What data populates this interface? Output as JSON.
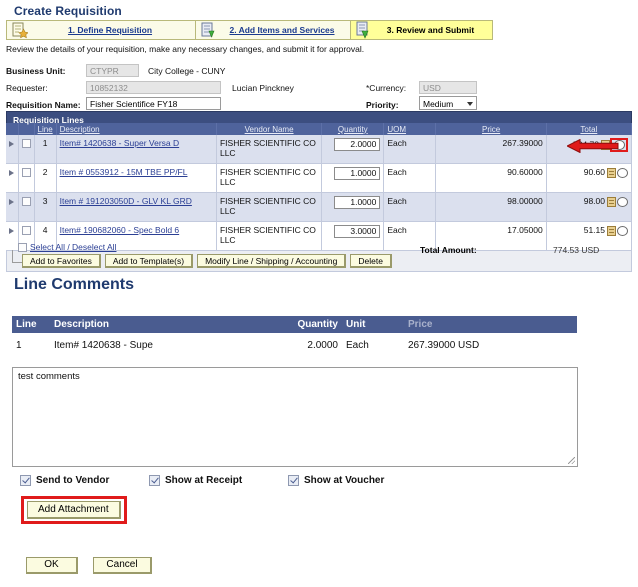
{
  "page": {
    "title": "Create Requisition",
    "intro": "Review the details of your requisition, make any necessary changes, and submit it for approval."
  },
  "steps": [
    {
      "label": "1. Define Requisition",
      "icon": "new-document-icon",
      "active": false
    },
    {
      "label": "2. Add Items and Services",
      "icon": "add-items-icon",
      "active": false
    },
    {
      "label": "3. Review and Submit",
      "icon": "review-submit-icon",
      "active": true
    }
  ],
  "header_form": {
    "business_unit_label": "Business Unit:",
    "business_unit_value": "CTYPR",
    "business_unit_desc": "City College - CUNY",
    "requester_label": "Requester:",
    "requester_value": "10852132",
    "requester_name": "Lucian Pinckney",
    "requisition_name_label": "Requisition Name:",
    "requisition_name_value": "Fisher Scientifice FY18",
    "currency_label": "*Currency:",
    "currency_value": "USD",
    "priority_label": "Priority:",
    "priority_value": "Medium"
  },
  "lines_grid": {
    "title": "Requisition Lines",
    "columns": [
      "Line",
      "Description",
      "Vendor Name",
      "Quantity",
      "UOM",
      "Price",
      "Total"
    ],
    "rows": [
      {
        "line": "1",
        "description": "Item# 1420638 - Super Versa D",
        "vendor": "FISHER SCIENTIFIC CO LLC",
        "quantity": "2.0000",
        "uom": "Each",
        "price": "267.39000",
        "total": "534.78",
        "highlighted": true
      },
      {
        "line": "2",
        "description": "Item # 0553912 - 15M TBE PP/FL",
        "vendor": "FISHER SCIENTIFIC CO LLC",
        "quantity": "1.0000",
        "uom": "Each",
        "price": "90.60000",
        "total": "90.60",
        "highlighted": false
      },
      {
        "line": "3",
        "description": "Item # 191203050D - GLV KL GRD",
        "vendor": "FISHER SCIENTIFIC CO LLC",
        "quantity": "1.0000",
        "uom": "Each",
        "price": "98.00000",
        "total": "98.00",
        "highlighted": false
      },
      {
        "line": "4",
        "description": "Item# 190682060 - Spec Bold 6",
        "vendor": "FISHER SCIENTIFIC CO LLC",
        "quantity": "3.0000",
        "uom": "Each",
        "price": "17.05000",
        "total": "51.15",
        "highlighted": false
      }
    ],
    "select_all_label": "Select All / Deselect All",
    "actions": [
      "Add to Favorites",
      "Add to Template(s)",
      "Modify Line / Shipping / Accounting",
      "Delete"
    ],
    "total_amount_label": "Total Amount:",
    "total_amount_value": "774.53 USD"
  },
  "line_comments": {
    "heading": "Line Comments",
    "columns": [
      "Line",
      "Description",
      "Quantity",
      "Unit",
      "Price"
    ],
    "row": {
      "line": "1",
      "description": "Item# 1420638 - Supe",
      "quantity": "2.0000",
      "unit": "Each",
      "price": "267.39000 USD"
    },
    "comment_text": "test comments",
    "checkboxes": [
      {
        "label": "Send to Vendor",
        "checked": true
      },
      {
        "label": "Show at Receipt",
        "checked": true
      },
      {
        "label": "Show at Voucher",
        "checked": true
      }
    ],
    "add_attachment_label": "Add Attachment"
  },
  "footer": {
    "ok_label": "OK",
    "cancel_label": "Cancel"
  },
  "colors": {
    "title_blue": "#1f3a6e",
    "grid_header_blue": "#4f639c",
    "grid_title_blue": "#3c4e80",
    "active_step_yellow": "#ffff99",
    "annotation_red": "#e01b1b",
    "link_blue": "#2b3f94"
  }
}
